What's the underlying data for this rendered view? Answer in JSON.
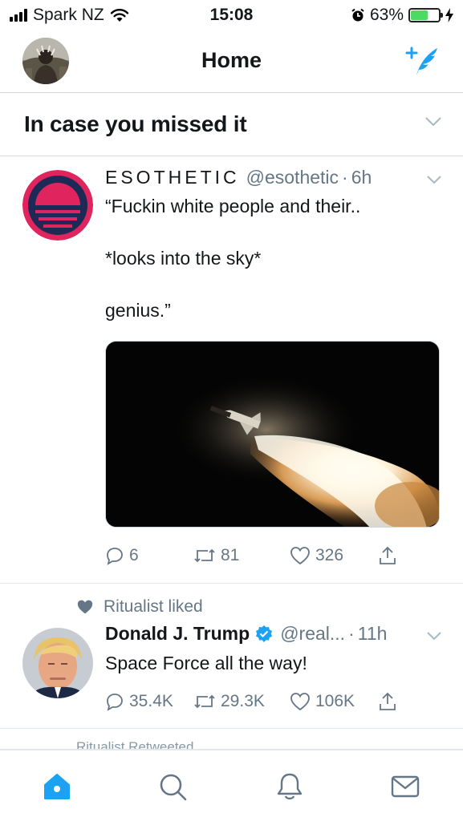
{
  "status_bar": {
    "carrier": "Spark NZ",
    "time": "15:08",
    "battery_percent": "63%",
    "battery_level": 0.63,
    "icons": [
      "signal-icon",
      "wifi-icon",
      "alarm-icon",
      "battery-icon",
      "charging-icon"
    ]
  },
  "nav": {
    "title": "Home",
    "icons": [
      "profile-avatar",
      "compose-tweet-icon"
    ]
  },
  "section": {
    "title": "In case you missed it",
    "icon": "chevron-down-icon"
  },
  "tweets": [
    {
      "name": "ESOTHETIC",
      "handle": "@esothetic",
      "separator": "·",
      "time": "6h",
      "text": "“Fuckin white people and their..\n\n*looks into the sky*\n\ngenius.”",
      "media": "rocket-launch-photo",
      "replies": "6",
      "retweets": "81",
      "likes": "326",
      "accent": "#e0245e"
    },
    {
      "context": "Ritualist liked",
      "name": "Donald J. Trump",
      "handle": "@real...",
      "separator": "·",
      "time": "11h",
      "text": "Space Force all the way!",
      "replies": "35.4K",
      "retweets": "29.3K",
      "likes": "106K",
      "verified": true
    }
  ],
  "next_context": "Ritualist Retweeted",
  "tabbar": {
    "tabs": [
      "home-icon",
      "search-icon",
      "notifications-icon",
      "messages-icon"
    ],
    "active_color": "#1da1f2",
    "inactive_color": "#657786"
  }
}
